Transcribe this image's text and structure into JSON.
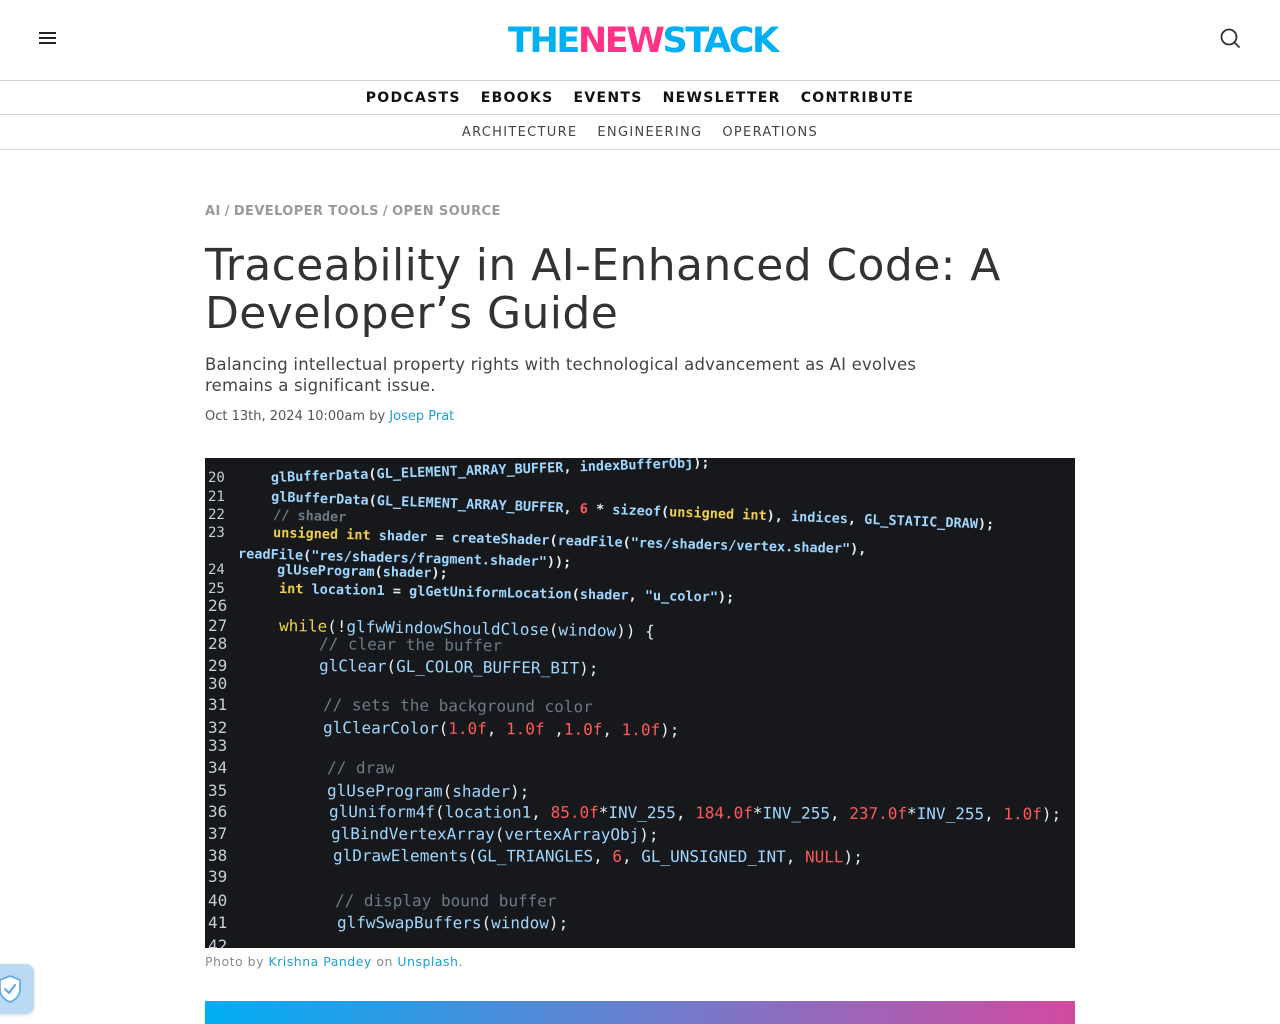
{
  "header": {
    "logo": {
      "part1": "THE",
      "part2": "NEW",
      "part3": "STACK"
    },
    "menu_icon": "hamburger-menu-icon",
    "search_icon": "search-icon"
  },
  "primary_nav": [
    "PODCASTS",
    "EBOOKS",
    "EVENTS",
    "NEWSLETTER",
    "CONTRIBUTE"
  ],
  "secondary_nav": [
    "ARCHITECTURE",
    "ENGINEERING",
    "OPERATIONS"
  ],
  "article": {
    "categories": [
      "AI",
      "DEVELOPER TOOLS",
      "OPEN SOURCE"
    ],
    "category_separator": "/",
    "title": "Traceability in AI-Enhanced Code: A Developer’s Guide",
    "subtitle": "Balancing intellectual property rights with technological advancement as AI evolves remains a significant issue.",
    "date": "Oct 13th, 2024 10:00am",
    "by": "by",
    "author": "Josep Prat"
  },
  "hero_image": {
    "code_lines": [
      {
        "n": "20",
        "code": "glBufferData(GL_ELEMENT_ARRAY_BUFFER, indexBufferObj);"
      },
      {
        "n": "21",
        "code": "glBufferData(GL_ELEMENT_ARRAY_BUFFER, 6 * sizeof(unsigned int), indices, GL_STATIC_DRAW);"
      },
      {
        "n": "22",
        "code": "// shader"
      },
      {
        "n": "23",
        "code": "unsigned int shader = createShader(readFile(\"res/shaders/vertex.shader\"),"
      },
      {
        "n": "",
        "code": "readFile(\"res/shaders/fragment.shader\"));"
      },
      {
        "n": "24",
        "code": "glUseProgram(shader);"
      },
      {
        "n": "25",
        "code": "int location1 = glGetUniformLocation(shader, \"u_color\");"
      },
      {
        "n": "26",
        "code": ""
      },
      {
        "n": "27",
        "code": "while(!glfwWindowShouldClose(window)) {"
      },
      {
        "n": "28",
        "code": "// clear the buffer"
      },
      {
        "n": "29",
        "code": "glClear(GL_COLOR_BUFFER_BIT);"
      },
      {
        "n": "30",
        "code": ""
      },
      {
        "n": "31",
        "code": "// sets the background color"
      },
      {
        "n": "32",
        "code": "glClearColor(1.0f, 1.0f ,1.0f, 1.0f);"
      },
      {
        "n": "33",
        "code": ""
      },
      {
        "n": "34",
        "code": "// draw"
      },
      {
        "n": "35",
        "code": "glUseProgram(shader);"
      },
      {
        "n": "36",
        "code": "glUniform4f(location1, 85.0f*INV_255, 184.0f*INV_255, 237.0f*INV_255, 1.0f);"
      },
      {
        "n": "37",
        "code": "glBindVertexArray(vertexArrayObj);"
      },
      {
        "n": "38",
        "code": "glDrawElements(GL_TRIANGLES, 6, GL_UNSIGNED_INT, NULL);"
      },
      {
        "n": "39",
        "code": ""
      },
      {
        "n": "40",
        "code": "// display bound buffer"
      },
      {
        "n": "41",
        "code": "glfwSwapBuffers(window);"
      },
      {
        "n": "42",
        "code": ""
      }
    ],
    "colors": {
      "background": "#16181b",
      "keyword": "#f0d04a",
      "func": "#9fd7ff",
      "comment": "#6b7a86",
      "number": "#ff5a5a",
      "text": "#e6edf2",
      "lineno": "#c8ced4"
    }
  },
  "caption": {
    "prefix": "Photo by",
    "photographer": "Krishna Pandey",
    "on": "on",
    "source": "Unsplash",
    "suffix": "."
  },
  "widgets": {
    "privacy_icon": "shield-check-icon"
  },
  "colors": {
    "brand_blue": "#00aff4",
    "brand_pink": "#ff3287",
    "link": "#1aa0d8"
  }
}
